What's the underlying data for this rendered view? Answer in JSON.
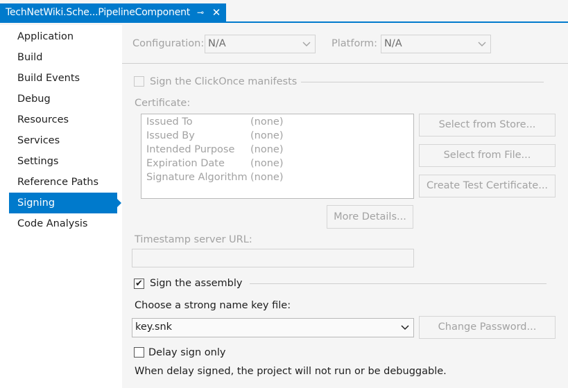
{
  "tab": {
    "title": "TechNetWiki.Sche...PipelineComponent",
    "pin_glyph": "⊸",
    "close_glyph": "✕"
  },
  "sidebar": {
    "items": [
      {
        "label": "Application"
      },
      {
        "label": "Build"
      },
      {
        "label": "Build Events"
      },
      {
        "label": "Debug"
      },
      {
        "label": "Resources"
      },
      {
        "label": "Services"
      },
      {
        "label": "Settings"
      },
      {
        "label": "Reference Paths"
      },
      {
        "label": "Signing",
        "active": true
      },
      {
        "label": "Code Analysis"
      }
    ]
  },
  "config": {
    "configuration_label": "Configuration:",
    "configuration_value": "N/A",
    "platform_label": "Platform:",
    "platform_value": "N/A"
  },
  "clickonce": {
    "checkbox_label": "Sign the ClickOnce manifests",
    "checked": false,
    "enabled": false
  },
  "certificate": {
    "label": "Certificate:",
    "rows": [
      {
        "key": "Issued To",
        "value": "(none)"
      },
      {
        "key": "Issued By",
        "value": "(none)"
      },
      {
        "key": "Intended Purpose",
        "value": "(none)"
      },
      {
        "key": "Expiration Date",
        "value": "(none)"
      },
      {
        "key": "Signature Algorithm",
        "value": "(none)"
      }
    ],
    "select_from_store": "Select from Store...",
    "select_from_file": "Select from File...",
    "create_test_cert": "Create Test Certificate...",
    "more_details": "More Details..."
  },
  "timestamp": {
    "label": "Timestamp server URL:",
    "value": ""
  },
  "assembly": {
    "checkbox_label": "Sign the assembly",
    "checked": true,
    "key_file_label": "Choose a strong name key file:",
    "key_file_value": "key.snk",
    "change_password": "Change Password..."
  },
  "delay": {
    "checkbox_label": "Delay sign only",
    "checked": false,
    "note": "When delay signed, the project will not run or be debuggable."
  },
  "colors": {
    "accent": "#007acc",
    "disabled_text": "#a2a2a2",
    "background": "#f5f5f5"
  }
}
